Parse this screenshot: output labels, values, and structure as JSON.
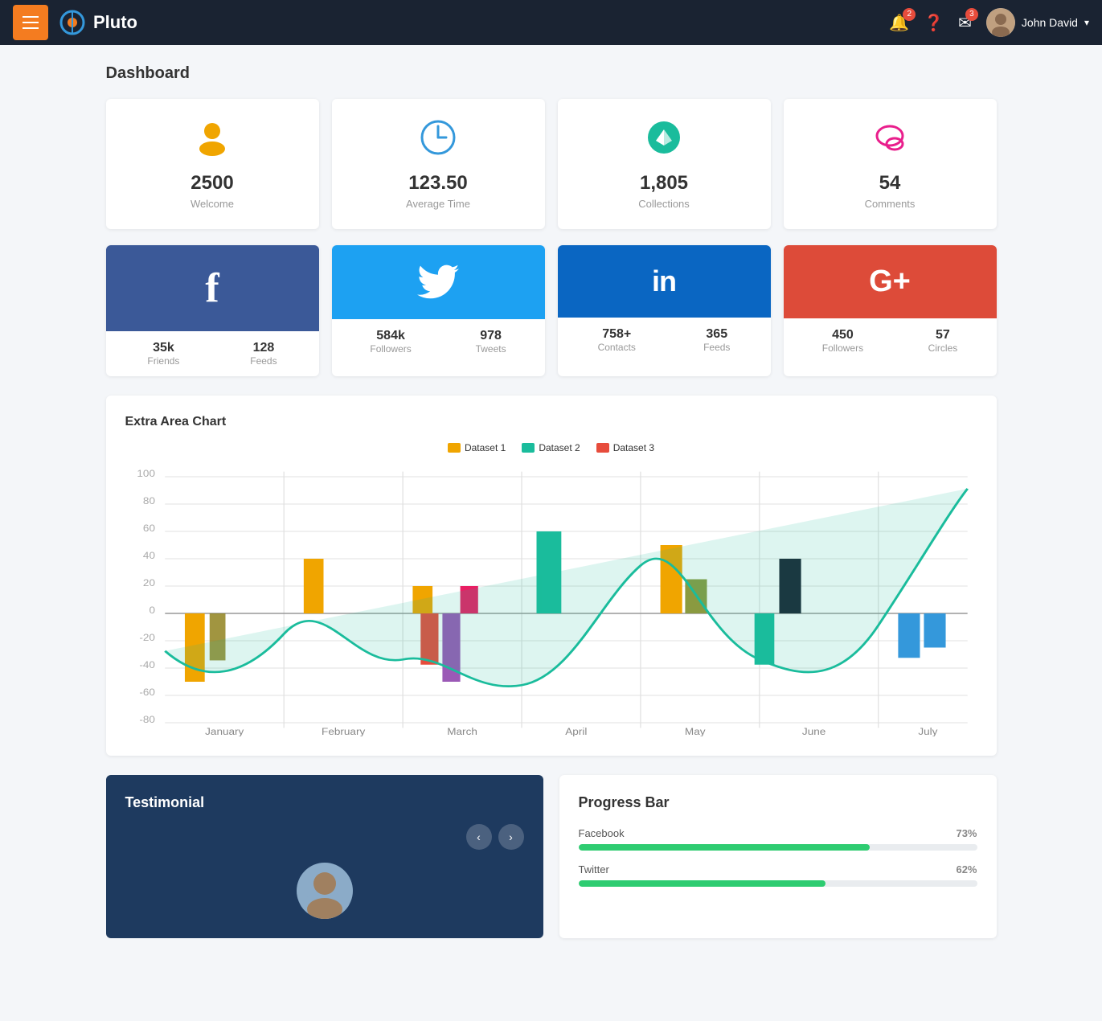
{
  "navbar": {
    "menu_label": "Menu",
    "brand_name": "Pluto",
    "notification_badge": "2",
    "help_label": "Help",
    "messages_badge": "3",
    "user_name": "John David",
    "user_chevron": "▾"
  },
  "page": {
    "title": "Dashboard"
  },
  "stat_cards": [
    {
      "icon": "👤",
      "icon_color": "#f0a500",
      "value": "2500",
      "label": "Welcome"
    },
    {
      "icon": "🕐",
      "icon_color": "#3498db",
      "value": "123.50",
      "label": "Average Time"
    },
    {
      "icon": "⬇",
      "icon_color": "#1abc9c",
      "value": "1,805",
      "label": "Collections"
    },
    {
      "icon": "💬",
      "icon_color": "#e91e8c",
      "value": "54",
      "label": "Comments"
    }
  ],
  "social_cards": [
    {
      "platform": "Facebook",
      "icon": "f",
      "header_class": "fb-header",
      "stats": [
        {
          "value": "35k",
          "label": "Friends"
        },
        {
          "value": "128",
          "label": "Feeds"
        }
      ]
    },
    {
      "platform": "Twitter",
      "icon": "𝕏",
      "header_class": "tw-header",
      "stats": [
        {
          "value": "584k",
          "label": "Followers"
        },
        {
          "value": "978",
          "label": "Tweets"
        }
      ]
    },
    {
      "platform": "LinkedIn",
      "icon": "in",
      "header_class": "li-header",
      "stats": [
        {
          "value": "758+",
          "label": "Contacts"
        },
        {
          "value": "365",
          "label": "Feeds"
        }
      ]
    },
    {
      "platform": "Google Plus",
      "icon": "G+",
      "header_class": "gp-header",
      "stats": [
        {
          "value": "450",
          "label": "Followers"
        },
        {
          "value": "57",
          "label": "Circles"
        }
      ]
    }
  ],
  "chart": {
    "title": "Extra Area Chart",
    "legend": [
      {
        "label": "Dataset 1",
        "color": "#f0a500"
      },
      {
        "label": "Dataset 2",
        "color": "#1abc9c"
      },
      {
        "label": "Dataset 3",
        "color": "#e74c3c"
      }
    ],
    "months": [
      "January",
      "February",
      "March",
      "April",
      "May",
      "June",
      "July"
    ],
    "y_labels": [
      "100",
      "80",
      "60",
      "40",
      "20",
      "0",
      "-20",
      "-40",
      "-60",
      "-80"
    ]
  },
  "testimonial": {
    "title": "Testimonial",
    "prev_label": "‹",
    "next_label": "›"
  },
  "progress": {
    "title": "Progress Bar",
    "items": [
      {
        "label": "Facebook",
        "pct": 73,
        "pct_text": "73%",
        "color": "#2ecc71"
      },
      {
        "label": "Twitter",
        "pct": 62,
        "pct_text": "62%",
        "color": "#2ecc71"
      }
    ]
  }
}
